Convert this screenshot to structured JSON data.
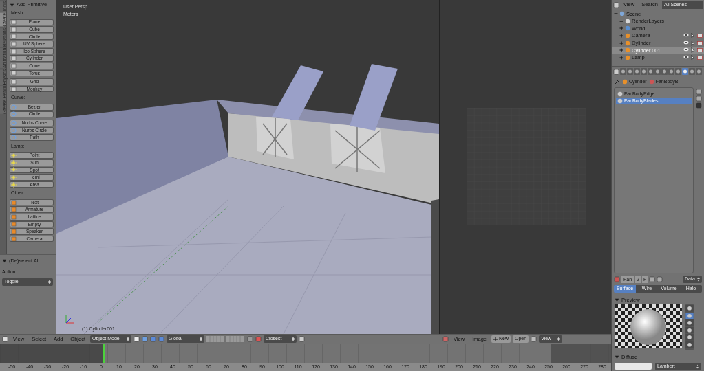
{
  "tool_shelf": {
    "tabs": [
      {
        "label": "Tools",
        "selected": false
      },
      {
        "label": "Create",
        "selected": true
      },
      {
        "label": "Relations",
        "selected": false
      },
      {
        "label": "Animation",
        "selected": false
      },
      {
        "label": "Physics",
        "selected": false
      },
      {
        "label": "Grease Pencil",
        "selected": false
      }
    ],
    "panel": {
      "title": "Add Primitive",
      "expanded": true,
      "groups": [
        {
          "label": "Mesh:",
          "kind": "mesh",
          "blocks": [
            [
              "Plane",
              "Cube",
              "Circle",
              "UV Sphere",
              "Ico Sphere",
              "Cylinder",
              "Cone",
              "Torus"
            ],
            [
              "Grid",
              "Monkey"
            ]
          ]
        },
        {
          "label": "Curve:",
          "kind": "curve",
          "blocks": [
            [
              "Bezier",
              "Circle"
            ],
            [
              "Nurbs Curve",
              "Nurbs Circle",
              "Path"
            ]
          ]
        },
        {
          "label": "Lamp:",
          "kind": "lamp",
          "blocks": [
            [
              "Point",
              "Sun",
              "Spot",
              "Hemi",
              "Area"
            ]
          ]
        },
        {
          "label": "Other:",
          "kind": "other",
          "blocks": [
            [
              "Text",
              "Armature",
              "Lattice",
              "Empty",
              "Speaker",
              "Camera"
            ]
          ]
        }
      ]
    }
  },
  "operator_panel": {
    "title": "(De)select All",
    "expanded": true,
    "field_label": "Action",
    "value": "Toggle"
  },
  "viewport": {
    "view_name": "User Persp",
    "units": "Meters",
    "object_label": "(1) Cylinder001"
  },
  "viewport_header": {
    "menus": [
      "View",
      "Select",
      "Add",
      "Object"
    ],
    "mode": "Object Mode",
    "orientation": "Global",
    "snap_target": "Closest"
  },
  "image_editor_header": {
    "menus": [
      "View",
      "Image"
    ],
    "new_button": "New",
    "open_button": "Open",
    "view_dropdown": "View"
  },
  "timeline": {
    "ruler": [
      "-50",
      "-40",
      "-30",
      "-20",
      "-10",
      "0",
      "10",
      "20",
      "30",
      "40",
      "50",
      "60",
      "70",
      "80",
      "90",
      "100",
      "110",
      "120",
      "130",
      "140",
      "150",
      "160",
      "170",
      "180",
      "190",
      "200",
      "210",
      "220",
      "230",
      "240",
      "250",
      "260",
      "270",
      "280"
    ]
  },
  "outliner": {
    "menus": [
      "View",
      "Search"
    ],
    "display": "All Scenes",
    "tree": [
      {
        "label": "Scene",
        "kind": "scene",
        "expanded": true,
        "selected": false,
        "children": [
          {
            "label": "RenderLayers",
            "kind": "layers",
            "expanded": true,
            "selected": false
          },
          {
            "label": "World",
            "kind": "world",
            "expanded": false,
            "selected": false
          },
          {
            "label": "Camera",
            "kind": "camera",
            "expanded": false,
            "selected": false
          },
          {
            "label": "Cylinder",
            "kind": "mesh",
            "expanded": false,
            "selected": false
          },
          {
            "label": "Cylinder.001",
            "kind": "mesh",
            "expanded": false,
            "selected": true
          },
          {
            "label": "Lamp",
            "kind": "lamp",
            "expanded": false,
            "selected": false
          }
        ]
      }
    ]
  },
  "properties": {
    "tabs": [
      {
        "selected": false
      },
      {
        "selected": false
      },
      {
        "selected": false
      },
      {
        "selected": false
      },
      {
        "selected": false
      },
      {
        "selected": false
      },
      {
        "selected": false
      },
      {
        "selected": false
      },
      {
        "selected": false
      },
      {
        "selected": true
      },
      {
        "selected": false
      },
      {
        "selected": false
      }
    ],
    "breadcrumb": [
      "Cylinder",
      "FanBodyB"
    ],
    "slots": [
      {
        "label": "FanBodyEdge",
        "selected": false
      },
      {
        "label": "FanBodyBlades",
        "selected": true
      }
    ],
    "datablock": {
      "name": "Fan",
      "users": "2",
      "fake_user": "F",
      "link": "Data"
    },
    "material_tabs": [
      {
        "label": "Surface",
        "selected": true
      },
      {
        "label": "Wire",
        "selected": false
      },
      {
        "label": "Volume",
        "selected": false
      },
      {
        "label": "Halo",
        "selected": false
      }
    ],
    "preview": {
      "title": "Preview",
      "expanded": true,
      "types": [
        {
          "selected": false
        },
        {
          "selected": true
        },
        {
          "selected": false
        },
        {
          "selected": false
        },
        {
          "selected": false
        },
        {
          "selected": false
        }
      ]
    },
    "diffuse": {
      "title": "Diffuse",
      "expanded": true,
      "shader": "Lambert"
    }
  }
}
